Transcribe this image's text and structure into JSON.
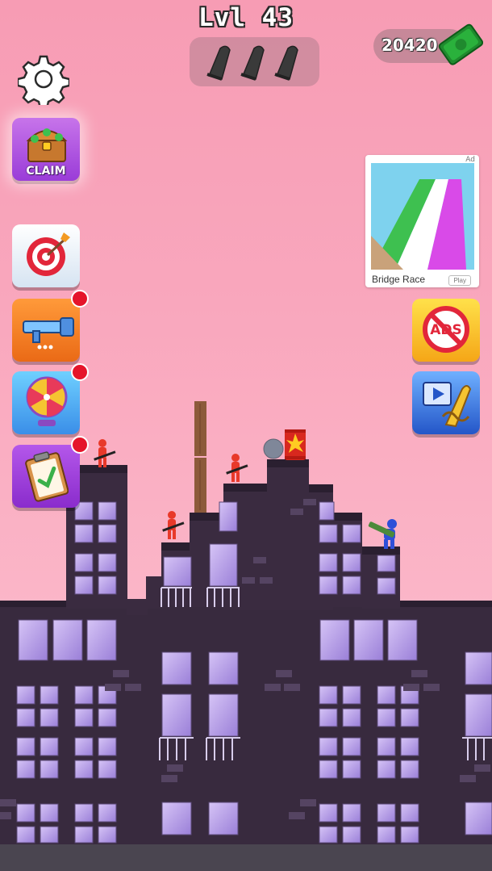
{
  "hud": {
    "level_label": "Lvl 43",
    "bullets_remaining": 3,
    "cash_amount": "20420"
  },
  "left_menu": {
    "claim_label": "CLAIM",
    "items": [
      {
        "name": "target",
        "badge": false
      },
      {
        "name": "weapons",
        "badge": true
      },
      {
        "name": "spin-wheel",
        "badge": true
      },
      {
        "name": "missions",
        "badge": true
      }
    ]
  },
  "ad": {
    "badge": "Ad",
    "title": "Bridge Race",
    "cta": "Play"
  },
  "right_menu": {
    "items": [
      "no-ads",
      "video-infinite-ammo"
    ]
  },
  "colors": {
    "sky_top": "#f79cb4",
    "building": "#3a2a40",
    "window": "#b69be6",
    "enemy": "#e8392a",
    "player": "#2e4fd8"
  }
}
